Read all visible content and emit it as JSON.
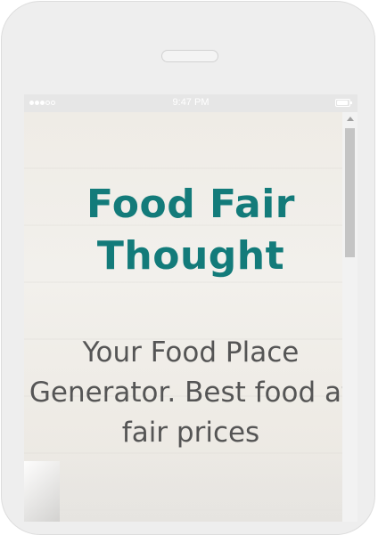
{
  "status_bar": {
    "time": "9:47 PM",
    "signal_bars_filled": 3,
    "signal_bars_total": 5,
    "battery_level": 0.9
  },
  "hero": {
    "title": "Food Fair Thought",
    "subtitle": "Your Food Place Generator. Best food at fair prices"
  },
  "scrollbar": {
    "scroll_position": 0.0
  },
  "colors": {
    "title": "#137b7a",
    "subtitle": "#555555",
    "phone_frame": "#eeeeee",
    "status_bar": "#e6e6e6"
  },
  "icons": {
    "signal": "signal-dots-icon",
    "battery": "battery-icon",
    "scroll_up": "scroll-up-arrow-icon"
  }
}
